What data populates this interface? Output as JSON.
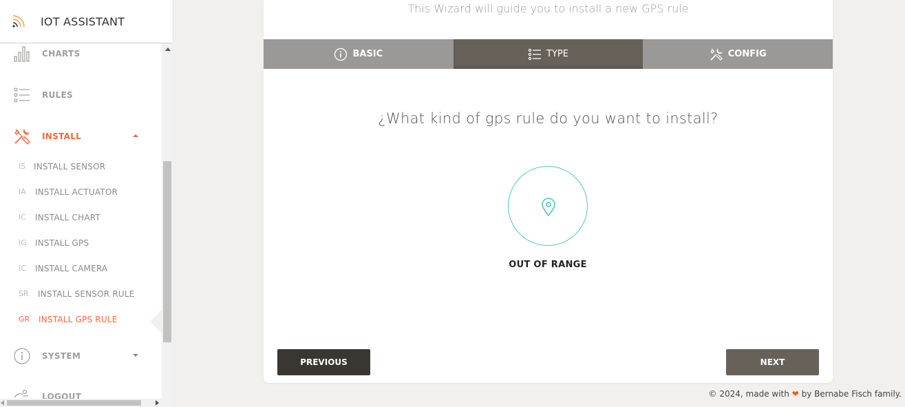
{
  "app": {
    "title": "IOT ASSISTANT"
  },
  "sidebar": {
    "items": [
      {
        "label": "CHARTS",
        "icon": "bar-chart-icon"
      },
      {
        "label": "RULES",
        "icon": "list-icon"
      },
      {
        "label": "INSTALL",
        "icon": "tools-icon",
        "expanded": true
      },
      {
        "label": "SYSTEM",
        "icon": "info-icon",
        "expanded": false
      },
      {
        "label": "LOGOUT",
        "icon": "logout-icon"
      }
    ],
    "install_subitems": [
      {
        "abbr": "IS",
        "label": "INSTALL SENSOR"
      },
      {
        "abbr": "IA",
        "label": "INSTALL ACTUATOR"
      },
      {
        "abbr": "IC",
        "label": "INSTALL CHART"
      },
      {
        "abbr": "IG",
        "label": "INSTALL GPS"
      },
      {
        "abbr": "IC",
        "label": "INSTALL CAMERA"
      },
      {
        "abbr": "SR",
        "label": "INSTALL SENSOR RULE"
      },
      {
        "abbr": "GR",
        "label": "INSTALL GPS RULE",
        "active": true
      }
    ]
  },
  "wizard": {
    "subtitle": "This Wizard will guide you to install a new GPS rule",
    "tabs": [
      {
        "label": "BASIC",
        "icon": "info-icon"
      },
      {
        "label": "TYPE",
        "icon": "list-icon",
        "active": true
      },
      {
        "label": "CONFIG",
        "icon": "tools-icon"
      }
    ],
    "question": "¿What kind of gps rule do you want to install?",
    "options": [
      {
        "label": "OUT OF RANGE",
        "icon": "map-pin-icon"
      }
    ],
    "previous_label": "PREVIOUS",
    "next_label": "NEXT"
  },
  "footer": {
    "prefix": "© 2024, made with",
    "heart": "❤",
    "suffix": "by Bernabe Fisch family."
  },
  "colors": {
    "accent": "#ec6a3d",
    "teal": "#4ec6c8",
    "tab_active": "#67615a",
    "tab_inactive": "#9b9997",
    "button_dark": "#3a3632"
  }
}
